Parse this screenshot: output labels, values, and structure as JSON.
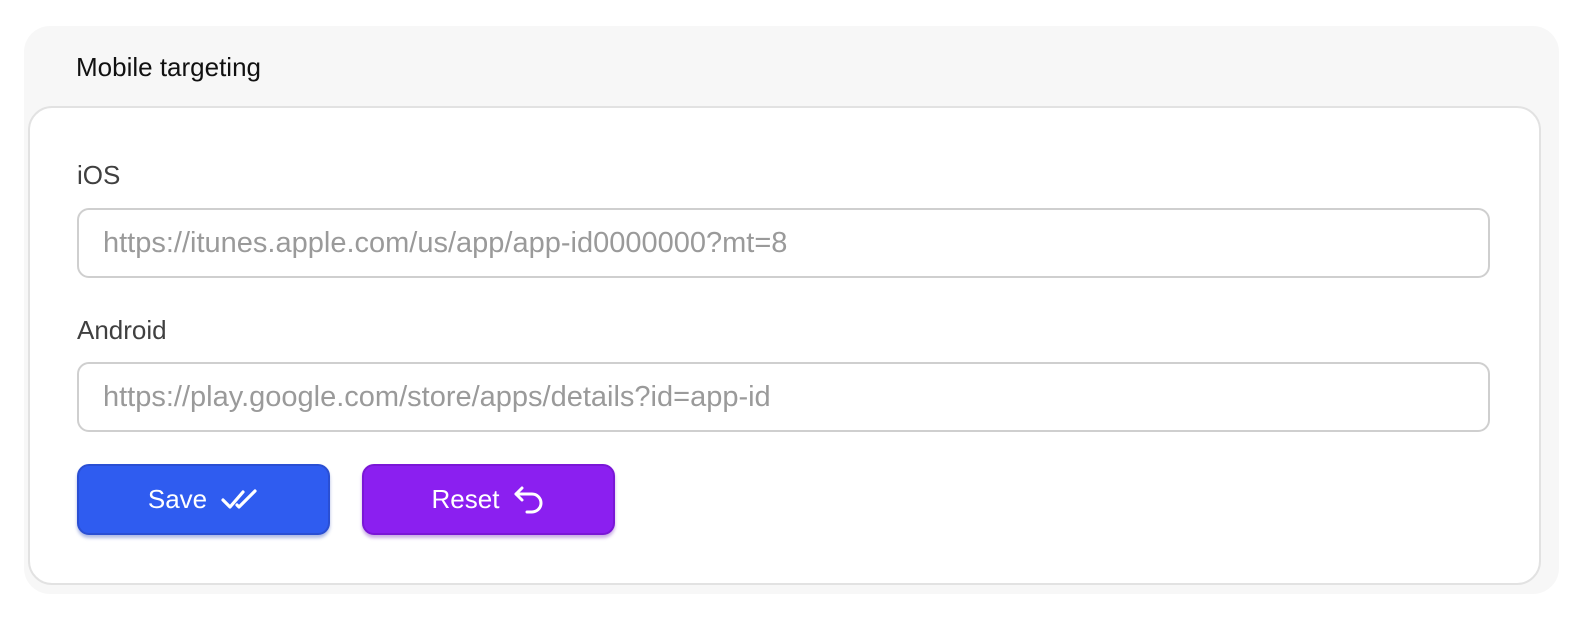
{
  "panel": {
    "title": "Mobile targeting"
  },
  "fields": {
    "ios": {
      "label": "iOS",
      "value": "",
      "placeholder": "https://itunes.apple.com/us/app/app-id0000000?mt=8"
    },
    "android": {
      "label": "Android",
      "value": "",
      "placeholder": "https://play.google.com/store/apps/details?id=app-id"
    }
  },
  "actions": {
    "save": {
      "label": "Save",
      "icon": "double-check-icon",
      "color": "#2f5cf0"
    },
    "reset": {
      "label": "Reset",
      "icon": "undo-arrow-icon",
      "color": "#8b1ff0"
    }
  }
}
